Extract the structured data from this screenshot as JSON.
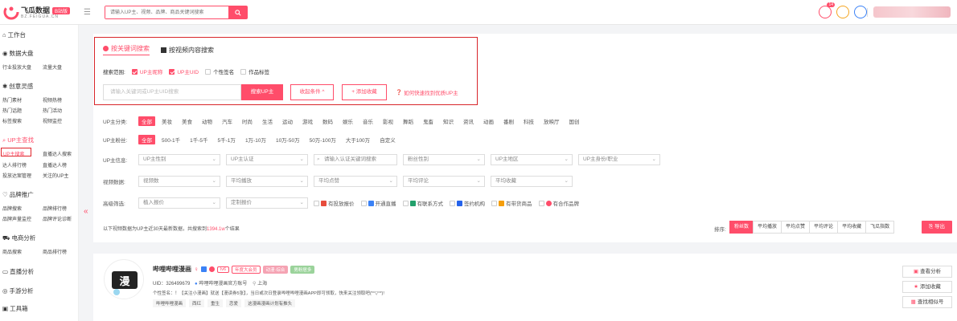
{
  "header": {
    "brand_name": "飞瓜数据",
    "brand_badge": "B站版",
    "brand_sub": "BZ.FEIGUA.CN",
    "search_placeholder": "请输入UP主、视频、品牌、商品关键词搜索",
    "notif_count": "14",
    "accent": "#ff4d6a"
  },
  "sidebar": {
    "workbench": "工作台",
    "data_screen": {
      "title": "数据大盘",
      "items": [
        "行业投放大盘",
        "流量大盘"
      ]
    },
    "creative": {
      "title": "创意灵感",
      "items": [
        "热门素材",
        "视频热榜",
        "热门话题",
        "热门活动",
        "标签搜索",
        "视频监控"
      ]
    },
    "up_search": {
      "title": "UP主查找",
      "items": [
        "UP主搜索",
        "直播达人搜索",
        "达人排行榜",
        "直播达人榜",
        "投放达案管理",
        "关注的UP主"
      ]
    },
    "brand": {
      "title": "品牌推广",
      "items": [
        "品牌搜索",
        "品牌排行榜",
        "品牌声量监控",
        "品牌评论诊断"
      ]
    },
    "ecom": {
      "title": "电商分析",
      "items": [
        "商品搜索",
        "商品排行榜"
      ]
    },
    "live": {
      "title": "直播分析"
    },
    "game": {
      "title": "手游分析"
    },
    "tools": {
      "title": "工具箱"
    }
  },
  "search_panel": {
    "tab_keyword": "按关键词搜索",
    "tab_content": "按视频内容搜索",
    "scope_label": "搜索范围:",
    "scope_options": [
      {
        "label": "UP主昵称",
        "checked": true
      },
      {
        "label": "UP主UID",
        "checked": true
      },
      {
        "label": "个性签名",
        "checked": false
      },
      {
        "label": "作品标签",
        "checked": false
      }
    ],
    "input_placeholder": "请输入关键词或UP主UID搜索",
    "search_button": "搜索UP主",
    "collapse_button": "收起条件 ^",
    "fav_button": "+ 添加收藏",
    "help_link": "如何快速找到优质UP主"
  },
  "filters": {
    "category_label": "UP主分类:",
    "categories": [
      "全部",
      "美妆",
      "美食",
      "动物",
      "汽车",
      "时尚",
      "生活",
      "运动",
      "游戏",
      "数码",
      "娱乐",
      "音乐",
      "影视",
      "舞蹈",
      "鬼畜",
      "知识",
      "资讯",
      "动画",
      "番剧",
      "科技",
      "放映厅",
      "国创"
    ],
    "fans_label": "UP主粉丝:",
    "fans_ranges": [
      "全部",
      "500-1千",
      "1千-5千",
      "5千-1万",
      "1万-10万",
      "10万-50万",
      "50万-100万",
      "大于100万",
      "自定义"
    ],
    "info_label": "UP主信息:",
    "info_selects": [
      "UP主性别",
      "UP主认证",
      "请输入认证关键词搜索",
      "粉丝性别",
      "UP主地区",
      "UP主身份/职业"
    ],
    "video_label": "视频数据:",
    "video_selects": [
      "视频数",
      "平均播放",
      "平均点赞",
      "平均评论",
      "平均收藏"
    ],
    "adv_label": "高级筛选:",
    "adv_selects": [
      "植入报价",
      "定制报价"
    ],
    "adv_checks": [
      "有投放报价",
      "开通直播",
      "有联系方式",
      "签约机构",
      "有带货商品",
      "有合作品牌"
    ]
  },
  "results": {
    "info_prefix": "以下视频数据为UP主近30天最新数据，共搜索到",
    "count": "1394.1w",
    "info_suffix": "个结果",
    "sort_label": "排序:",
    "sort_options": [
      "粉丝数",
      "平均播放",
      "平均点赞",
      "平均评论",
      "平均收藏",
      "飞瓜指数"
    ],
    "export": "导出"
  },
  "up_card": {
    "name": "哔哩哔哩漫画",
    "level": "lv6",
    "tag1": "年度大会员",
    "tag2": "动漫·综合",
    "tag3": "男粉居多",
    "uid": "UID：326499679",
    "verify": "哔哩哔哩漫画官方账号",
    "location": "上海",
    "sign": "个性签名：！【关注小漫画】就送【漫读券5张】，当日或次日登录哔哩哔哩漫画APP即可领取，快来关注领取吧(*°▽°*)!",
    "tags": [
      "哔哩哔哩漫画",
      "西红",
      "重生",
      "恋爱",
      "这漫画漫画计划有推头"
    ],
    "actions": [
      "查看分析",
      "添加收藏",
      "查找相似号"
    ]
  }
}
